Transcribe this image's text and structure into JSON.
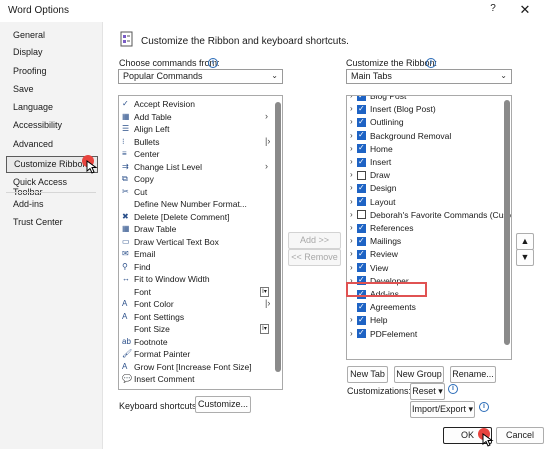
{
  "window": {
    "title": "Word Options",
    "help": "?",
    "close": "✕"
  },
  "nav": {
    "items": [
      "General",
      "Display",
      "Proofing",
      "Save",
      "Language",
      "Accessibility",
      "Advanced",
      "Customize Ribbon",
      "Quick Access Toolbar",
      "Add-ins",
      "Trust Center"
    ],
    "selected": "Customize Ribbon"
  },
  "header": {
    "text": "Customize the Ribbon and keyboard shortcuts."
  },
  "left": {
    "choose_label": "Choose commands from:",
    "choose_value": "Popular Commands",
    "commands": [
      {
        "label": "Accept Revision",
        "icon": "accept-revision-icon"
      },
      {
        "label": "Add Table",
        "icon": "table-icon",
        "sub": "›"
      },
      {
        "label": "Align Left",
        "icon": "align-left-icon"
      },
      {
        "label": "Bullets",
        "icon": "bullets-icon",
        "sub": "|›"
      },
      {
        "label": "Center",
        "icon": "center-icon"
      },
      {
        "label": "Change List Level",
        "icon": "list-level-icon",
        "sub": "›"
      },
      {
        "label": "Copy",
        "icon": "copy-icon"
      },
      {
        "label": "Cut",
        "icon": "cut-icon"
      },
      {
        "label": "Define New Number Format...",
        "icon": ""
      },
      {
        "label": "Delete [Delete Comment]",
        "icon": "delete-comment-icon"
      },
      {
        "label": "Draw Table",
        "icon": "draw-table-icon"
      },
      {
        "label": "Draw Vertical Text Box",
        "icon": "text-box-icon"
      },
      {
        "label": "Email",
        "icon": "email-icon"
      },
      {
        "label": "Find",
        "icon": "find-icon"
      },
      {
        "label": "Fit to Window Width",
        "icon": "fit-width-icon"
      },
      {
        "label": "Font",
        "icon": "",
        "side": "I▾"
      },
      {
        "label": "Font Color",
        "icon": "font-color-icon",
        "sub": "|›"
      },
      {
        "label": "Font Settings",
        "icon": "font-settings-icon"
      },
      {
        "label": "Font Size",
        "icon": "",
        "side": "I▾"
      },
      {
        "label": "Footnote",
        "icon": "footnote-icon"
      },
      {
        "label": "Format Painter",
        "icon": "format-painter-icon"
      },
      {
        "label": "Grow Font [Increase Font Size]",
        "icon": "grow-font-icon"
      },
      {
        "label": "Insert Comment",
        "icon": "comment-icon"
      }
    ],
    "shortcuts_label": "Keyboard shortcuts:",
    "customize_button": "Customize..."
  },
  "middle": {
    "add_button": "Add >>",
    "remove_button": "<< Remove"
  },
  "right": {
    "customize_label": "Customize the Ribbon:",
    "customize_value": "Main Tabs",
    "tabs": [
      {
        "label": "Blog Post",
        "checked": true,
        "expander": "›",
        "child": false
      },
      {
        "label": "Insert (Blog Post)",
        "checked": true,
        "expander": "›",
        "child": false
      },
      {
        "label": "Outlining",
        "checked": true,
        "expander": "›",
        "child": false
      },
      {
        "label": "Background Removal",
        "checked": true,
        "expander": "›",
        "child": false
      },
      {
        "label": "Home",
        "checked": true,
        "expander": "›",
        "child": false
      },
      {
        "label": "Insert",
        "checked": true,
        "expander": "›",
        "child": false
      },
      {
        "label": "Draw",
        "checked": false,
        "expander": "›",
        "child": false
      },
      {
        "label": "Design",
        "checked": true,
        "expander": "›",
        "child": false
      },
      {
        "label": "Layout",
        "checked": true,
        "expander": "›",
        "child": false
      },
      {
        "label": "Deborah's Favorite Commands (Custo",
        "checked": false,
        "expander": "›",
        "child": false
      },
      {
        "label": "References",
        "checked": true,
        "expander": "›",
        "child": false
      },
      {
        "label": "Mailings",
        "checked": true,
        "expander": "›",
        "child": false
      },
      {
        "label": "Review",
        "checked": true,
        "expander": "›",
        "child": false
      },
      {
        "label": "View",
        "checked": true,
        "expander": "›",
        "child": false
      },
      {
        "label": "Developer",
        "checked": true,
        "expander": "›",
        "child": false
      },
      {
        "label": "Add-ins",
        "checked": true,
        "expander": "",
        "child": true
      },
      {
        "label": "Agreements",
        "checked": true,
        "expander": "",
        "child": true
      },
      {
        "label": "Help",
        "checked": true,
        "expander": "›",
        "child": false
      },
      {
        "label": "PDFelement",
        "checked": true,
        "expander": "›",
        "child": false
      }
    ],
    "new_tab": "New Tab",
    "new_group": "New Group",
    "rename": "Rename...",
    "customizations_label": "Customizations:",
    "reset": "Reset ▾",
    "import_export": "Import/Export ▾",
    "move_up": "▲",
    "move_down": "▼"
  },
  "footer": {
    "ok": "OK",
    "cancel": "Cancel"
  },
  "colors": {
    "accent": "#1e63c4",
    "highlight": "#e05252",
    "nav_bg": "#f3f3f3"
  }
}
